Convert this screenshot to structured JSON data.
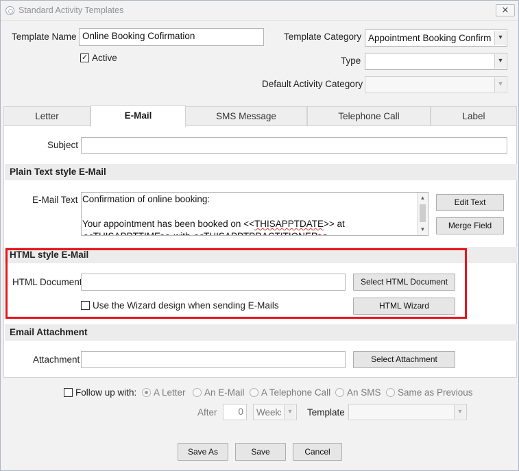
{
  "window": {
    "title": "Standard Activity Templates",
    "close_glyph": "✕"
  },
  "header": {
    "template_name_label": "Template Name",
    "template_name_value": "Online Booking Cofirmation",
    "active_label": "Active",
    "active_checked": true,
    "template_category_label": "Template Category",
    "template_category_value": "Appointment Booking Confirmation",
    "type_label": "Type",
    "type_value": "",
    "default_activity_category_label": "Default Activity Category",
    "default_activity_category_value": ""
  },
  "tabs": [
    {
      "label": "Letter",
      "active": false
    },
    {
      "label": "E-Mail",
      "active": true
    },
    {
      "label": "SMS Message",
      "active": false
    },
    {
      "label": "Telephone Call",
      "active": false
    },
    {
      "label": "Label",
      "active": false
    }
  ],
  "email": {
    "subject_label": "Subject",
    "subject_value": "",
    "plain_section_title": "Plain Text style E-Mail",
    "email_text_label": "E-Mail Text",
    "email_text_lines": [
      "Confirmation of online booking:",
      "",
      "Your appointment has been booked on <<",
      "THISAPPTDATE",
      ">> at",
      "<<THISAPPTTIME>> with <<THISAPPTPRACTITIONER>>"
    ],
    "edit_text_button": "Edit Text",
    "merge_field_button": "Merge Field",
    "html_section_title": "HTML style E-Mail",
    "html_document_label": "HTML Document",
    "html_document_value": "",
    "select_html_button": "Select HTML Document",
    "wizard_checkbox_label": "Use the Wizard design when sending E-Mails",
    "wizard_checked": false,
    "html_wizard_button": "HTML Wizard",
    "attachment_section_title": "Email Attachment",
    "attachment_label": "Attachment",
    "attachment_value": "",
    "select_attachment_button": "Select Attachment"
  },
  "followup": {
    "label": "Follow up with:",
    "checked": false,
    "options": [
      "A Letter",
      "An E-Mail",
      "A Telephone Call",
      "An SMS",
      "Same as Previous"
    ],
    "selected": "A Letter",
    "after_label": "After",
    "after_value": "0",
    "unit_value": "Weeks",
    "template_label": "Template",
    "template_value": ""
  },
  "footer": {
    "save_as_button": "Save As",
    "save_button": "Save",
    "cancel_button": "Cancel"
  },
  "colors": {
    "highlight_border": "#e8141c",
    "section_header_bg": "#ececec",
    "window_bg": "#f2f2f2"
  },
  "icons": {
    "window_icon": "app-icon",
    "close": "close-icon",
    "dropdown": "chevron-down-icon",
    "check": "checkmark-icon"
  }
}
